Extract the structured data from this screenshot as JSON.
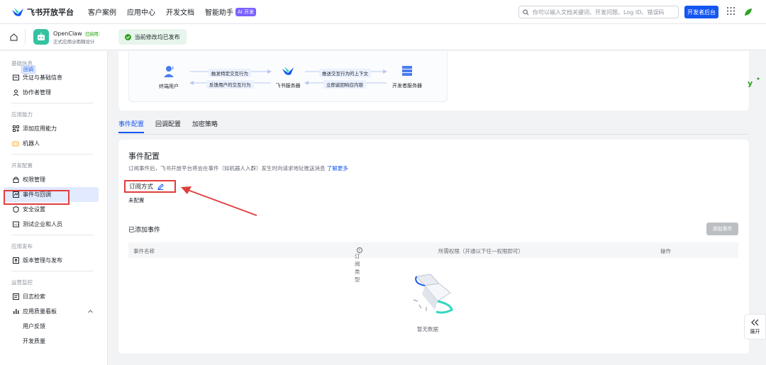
{
  "topbar": {
    "logo_text": "飞书开放平台",
    "nav": [
      "客户案例",
      "应用中心",
      "开发文档",
      "智能助手"
    ],
    "ai_badge": "AI 开发",
    "search_placeholder": "你可以输入文档关键词、开发问题、Log ID、错误码",
    "dev_button": "开发者后台"
  },
  "app": {
    "name": "OpenClaw",
    "tag": "已启用",
    "subtitle": "正式应用@雨翰设计",
    "publish_status": "当前修改均已发布"
  },
  "sidebar": {
    "groups": [
      {
        "title": "基础信息",
        "items": [
          "凭证与基础信息",
          "协作者管理"
        ]
      },
      {
        "title": "应用能力",
        "items": [
          "添加应用能力",
          "机器人"
        ]
      },
      {
        "title": "开发配置",
        "items": [
          "权限管理",
          "事件与回调",
          "安全设置",
          "测试企业和人员"
        ]
      },
      {
        "title": "应用发布",
        "items": [
          "版本管理与发布"
        ]
      },
      {
        "title": "运营监控",
        "items": [
          "日志检索",
          "应用质量看板",
          "用户反馈",
          "开发质量"
        ]
      }
    ]
  },
  "flow": {
    "callback_tag": "回调",
    "node_user": "终端用户",
    "node_feishu": "飞书服务器",
    "node_dev": "开发者服务器",
    "arrow1_top": "触发特定交互行为",
    "arrow1_bottom": "反馈用户的交互行为",
    "arrow2_top": "推送交互行为的上下文",
    "arrow2_bottom": "立即返回响应内容"
  },
  "tabs": [
    "事件配置",
    "回调配置",
    "加密策略"
  ],
  "event": {
    "title": "事件配置",
    "desc": "订阅事件后，飞书开放平台将会在事件（如机器人入群）发生时向请求地址推送消息",
    "learn_more": "了解更多",
    "sub_mode_label": "订阅方式",
    "sub_mode_value": "未配置",
    "added_title": "已添加事件",
    "add_button": "添加事件",
    "columns": [
      "事件名称",
      "订阅类型",
      "所需权限（开通以下任一权限即可）",
      "操作"
    ],
    "empty_text": "暂无数据"
  },
  "expand_label": "展开",
  "colors": {
    "primary": "#1456f0",
    "annotation_red": "#e03e3e",
    "success_bg": "#e7f5ec"
  }
}
